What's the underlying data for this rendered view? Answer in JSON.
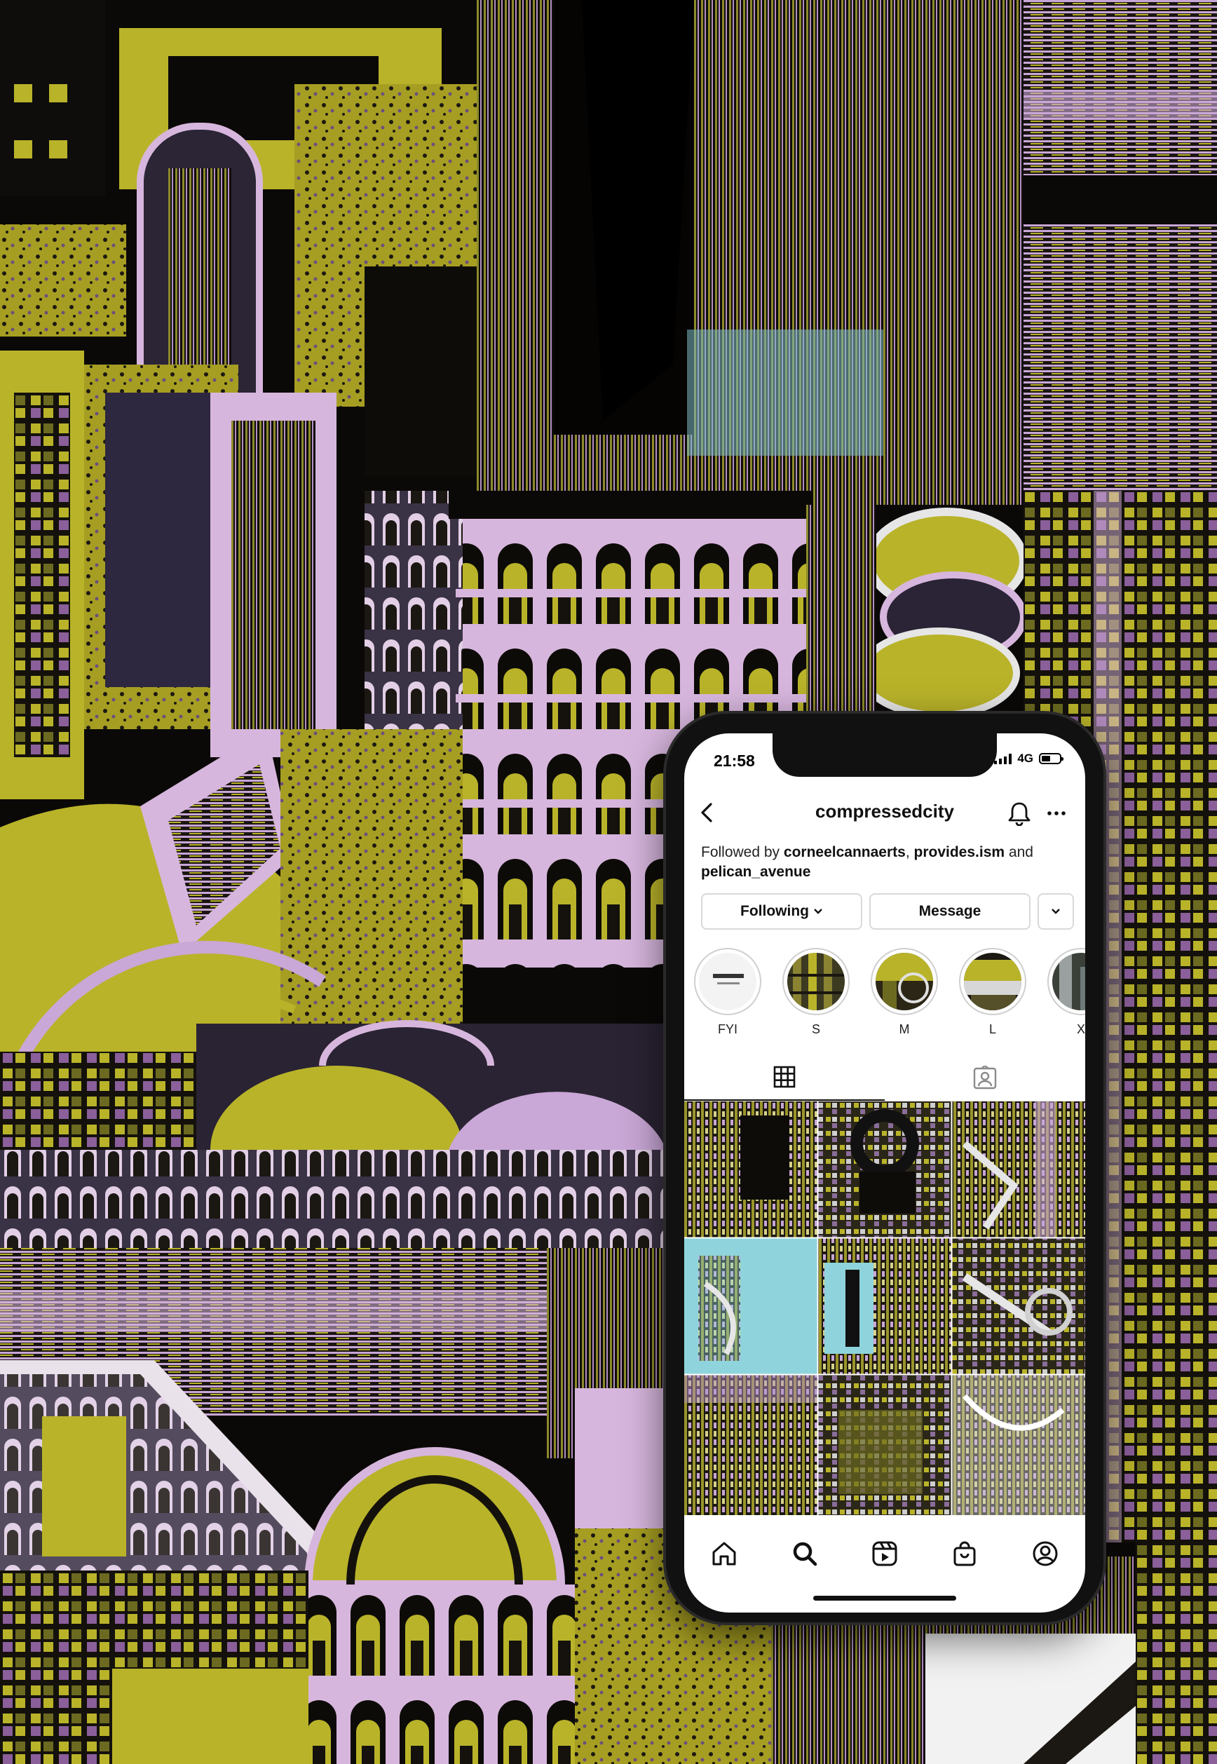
{
  "status_bar": {
    "time": "21:58",
    "network": "4G"
  },
  "header": {
    "username": "compressedcity"
  },
  "followed_by": {
    "prefix": "Followed by",
    "user1": "corneelcannaerts",
    "separator": ",",
    "user2": "provides.ism",
    "conjunction": "and",
    "user3": "pelican_avenue"
  },
  "actions": {
    "following_label": "Following",
    "message_label": "Message"
  },
  "highlights": [
    {
      "label": "FYI"
    },
    {
      "label": "S"
    },
    {
      "label": "M"
    },
    {
      "label": "L"
    },
    {
      "label": "X"
    }
  ],
  "tabs": [
    {
      "icon": "grid-icon"
    },
    {
      "icon": "tagged-icon"
    }
  ],
  "bottom_nav": [
    {
      "icon": "home-icon"
    },
    {
      "icon": "search-icon"
    },
    {
      "icon": "reels-icon"
    },
    {
      "icon": "shop-icon"
    },
    {
      "icon": "profile-icon"
    }
  ],
  "colors": {
    "olive": "#b9b32a",
    "lavender": "#c9a7d6",
    "purple": "#5b4a7e",
    "cyan": "#8fd4dc",
    "black": "#0b0908"
  }
}
